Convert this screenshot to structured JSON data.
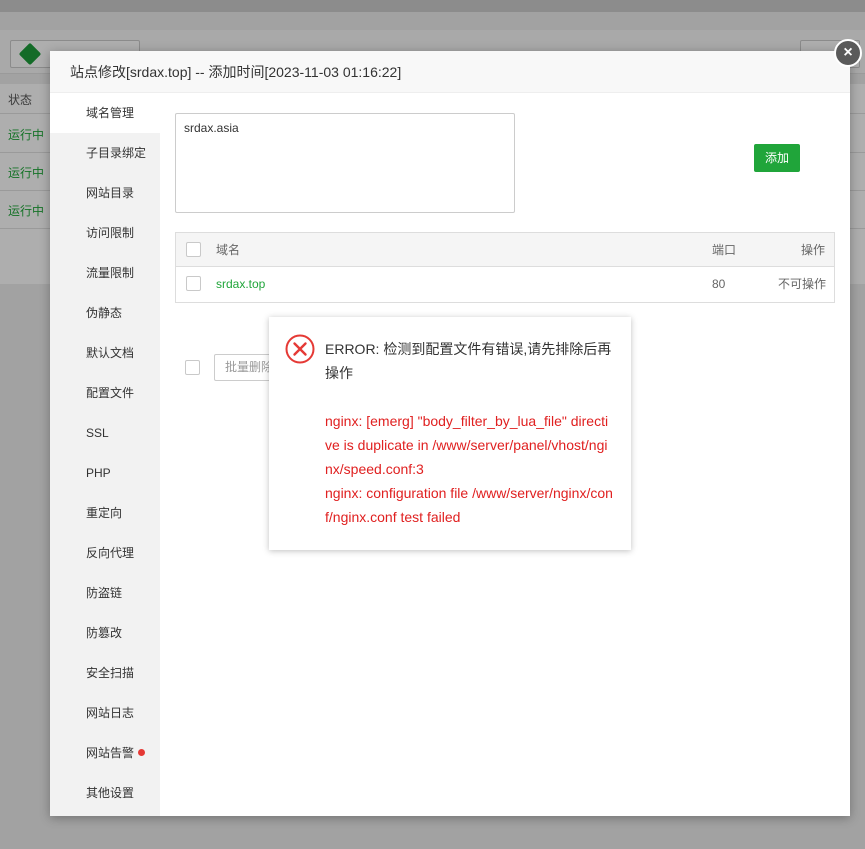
{
  "background": {
    "nginx_label": "N",
    "table_header": "状态",
    "rows": [
      "运行中",
      "运行中",
      "运行中"
    ]
  },
  "modal": {
    "title": "站点修改[srdax.top] -- 添加时间[2023-11-03 01:16:22]",
    "close_label": "×",
    "sidebar": [
      {
        "label": "域名管理",
        "active": true
      },
      {
        "label": "子目录绑定"
      },
      {
        "label": "网站目录"
      },
      {
        "label": "访问限制"
      },
      {
        "label": "流量限制"
      },
      {
        "label": "伪静态"
      },
      {
        "label": "默认文档"
      },
      {
        "label": "配置文件"
      },
      {
        "label": "SSL"
      },
      {
        "label": "PHP"
      },
      {
        "label": "重定向"
      },
      {
        "label": "反向代理"
      },
      {
        "label": "防盗链"
      },
      {
        "label": "防篡改"
      },
      {
        "label": "安全扫描"
      },
      {
        "label": "网站日志"
      },
      {
        "label": "网站告警",
        "badge": true
      },
      {
        "label": "其他设置"
      }
    ],
    "domain_input": {
      "value": "srdax.asia"
    },
    "add_button": "添加",
    "table": {
      "headers": {
        "domain": "域名",
        "port": "端口",
        "action": "操作"
      },
      "rows": [
        {
          "domain": "srdax.top",
          "port": "80",
          "action": "不可操作"
        }
      ]
    },
    "batch_delete": "批量删除"
  },
  "error_dialog": {
    "message": "ERROR: 检测到配置文件有错误,请先排除后再操作",
    "details": [
      "nginx: [emerg] \"body_filter_by_lua_file\" directive is duplicate in /www/server/panel/vhost/nginx/speed.conf:3",
      "nginx: configuration file /www/server/nginx/conf/nginx.conf test failed"
    ],
    "icon": "error-circle-icon",
    "accent_color": "#e02020"
  }
}
